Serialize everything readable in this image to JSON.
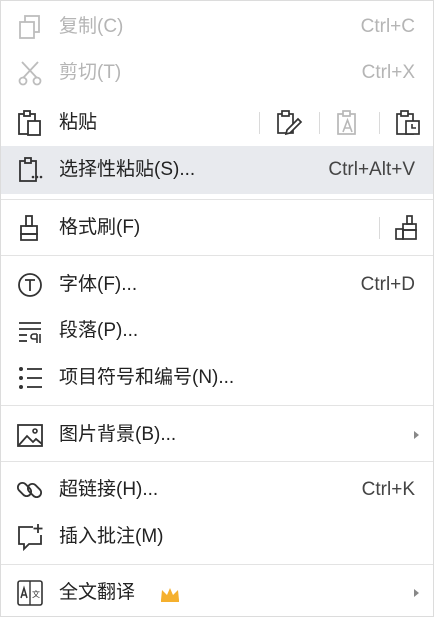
{
  "menu": {
    "copy": {
      "label": "复制(C)",
      "shortcut": "Ctrl+C",
      "icon": "copy-icon",
      "disabled": true
    },
    "cut": {
      "label": "剪切(T)",
      "shortcut": "Ctrl+X",
      "icon": "scissors-icon",
      "disabled": true
    },
    "paste": {
      "label": "粘贴",
      "icon": "clipboard-icon",
      "options": [
        "paste-keep-format-icon",
        "paste-text-only-icon",
        "paste-match-format-icon"
      ]
    },
    "paste_special": {
      "label": "选择性粘贴(S)...",
      "shortcut": "Ctrl+Alt+V",
      "icon": "clipboard-dots-icon",
      "highlighted": true
    },
    "format_painter": {
      "label": "格式刷(F)",
      "icon": "brush-icon",
      "extra_icon": "format-painter-icon"
    },
    "font": {
      "label": "字体(F)...",
      "shortcut": "Ctrl+D",
      "icon": "font-icon"
    },
    "paragraph": {
      "label": "段落(P)...",
      "icon": "paragraph-icon"
    },
    "bullets": {
      "label": "项目符号和编号(N)...",
      "icon": "list-icon"
    },
    "background": {
      "label": "图片背景(B)...",
      "icon": "image-icon",
      "submenu": true
    },
    "hyperlink": {
      "label": "超链接(H)...",
      "shortcut": "Ctrl+K",
      "icon": "link-icon"
    },
    "comment": {
      "label": "插入批注(M)",
      "icon": "comment-add-icon"
    },
    "translate": {
      "label": "全文翻译",
      "icon": "translate-icon",
      "badge_icon": "crown-icon",
      "badge_color": "#f5b02e",
      "submenu": true
    }
  },
  "colors": {
    "highlight_bg": "#e8eaee",
    "disabled_text": "#b5b5b5",
    "text": "#222222",
    "separator": "#e3e3e3"
  }
}
